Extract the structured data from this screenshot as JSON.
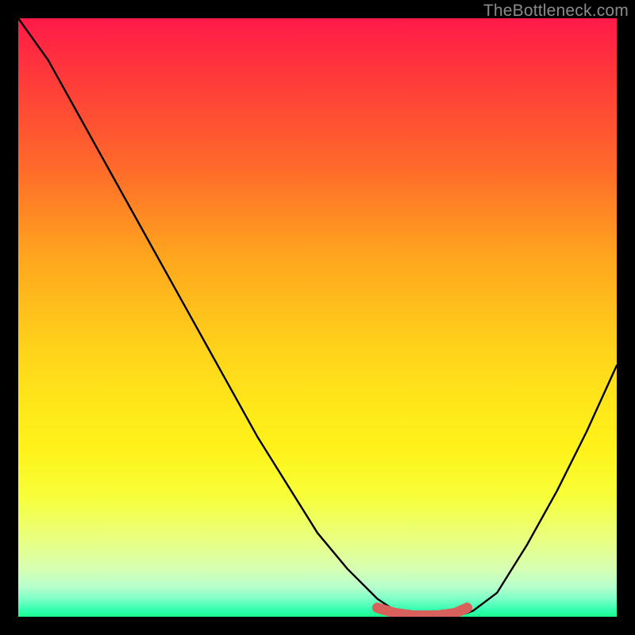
{
  "watermark": "TheBottleneck.com",
  "chart_data": {
    "type": "line",
    "title": "",
    "xlabel": "",
    "ylabel": "",
    "xlim": [
      0,
      100
    ],
    "ylim": [
      0,
      100
    ],
    "grid": false,
    "series": [
      {
        "name": "bottleneck-curve",
        "color": "#000000",
        "x": [
          0,
          5,
          10,
          15,
          20,
          25,
          30,
          35,
          40,
          45,
          50,
          55,
          60,
          63,
          66,
          70,
          73,
          76,
          80,
          85,
          90,
          95,
          100
        ],
        "y": [
          100,
          93,
          84,
          75,
          66,
          57,
          48,
          39,
          30,
          22,
          14,
          8,
          3,
          1,
          0,
          0,
          0,
          1,
          4,
          12,
          21,
          31,
          42
        ]
      },
      {
        "name": "optimal-band",
        "color": "#d9615b",
        "x": [
          60,
          63,
          66,
          70,
          73,
          75
        ],
        "y": [
          1.5,
          0.6,
          0.2,
          0.2,
          0.6,
          1.5
        ]
      }
    ],
    "gradient_stops": [
      {
        "pos": 0,
        "color": "#ff1a49"
      },
      {
        "pos": 25,
        "color": "#ff6a2a"
      },
      {
        "pos": 55,
        "color": "#ffd21a"
      },
      {
        "pos": 80,
        "color": "#f7ff3a"
      },
      {
        "pos": 95,
        "color": "#b6ffcc"
      },
      {
        "pos": 100,
        "color": "#1cff8b"
      }
    ]
  }
}
